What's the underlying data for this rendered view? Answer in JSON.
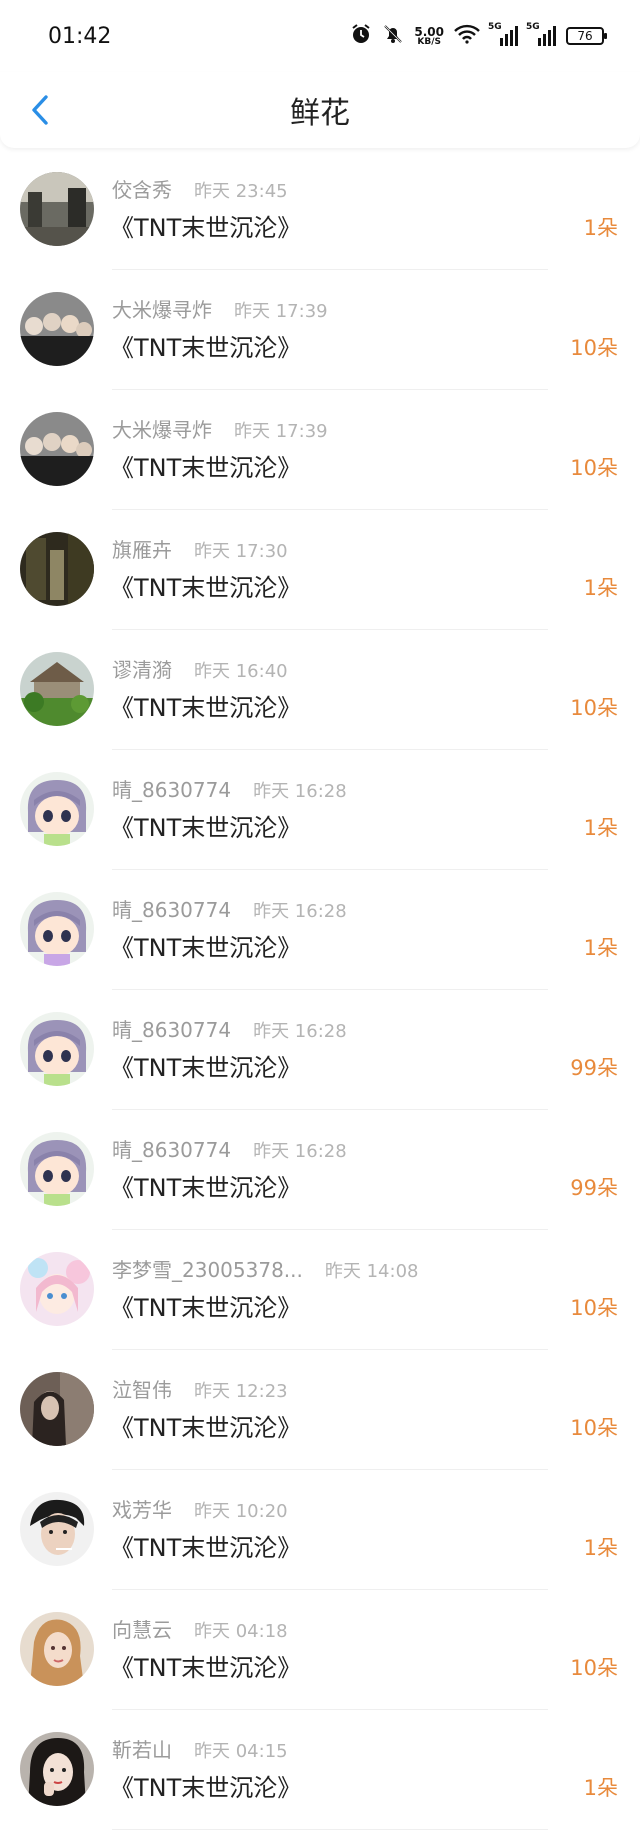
{
  "status_bar": {
    "time": "01:42",
    "net_speed": "5.00",
    "net_unit": "KB/S",
    "signal1_label": "5G",
    "signal2_label": "5G",
    "battery": "76"
  },
  "header": {
    "title": "鲜花"
  },
  "items": [
    {
      "username": "佼含秀",
      "time": "昨天 23:45",
      "book": "《TNT末世沉沦》",
      "count": "1朵"
    },
    {
      "username": "大米爆寻炸",
      "time": "昨天 17:39",
      "book": "《TNT末世沉沦》",
      "count": "10朵"
    },
    {
      "username": "大米爆寻炸",
      "time": "昨天 17:39",
      "book": "《TNT末世沉沦》",
      "count": "10朵"
    },
    {
      "username": "旗雁卉",
      "time": "昨天 17:30",
      "book": "《TNT末世沉沦》",
      "count": "1朵"
    },
    {
      "username": "谬清漪",
      "time": "昨天 16:40",
      "book": "《TNT末世沉沦》",
      "count": "10朵"
    },
    {
      "username": "晴_8630774",
      "time": "昨天 16:28",
      "book": "《TNT末世沉沦》",
      "count": "1朵"
    },
    {
      "username": "晴_8630774",
      "time": "昨天 16:28",
      "book": "《TNT末世沉沦》",
      "count": "1朵"
    },
    {
      "username": "晴_8630774",
      "time": "昨天 16:28",
      "book": "《TNT末世沉沦》",
      "count": "99朵"
    },
    {
      "username": "晴_8630774",
      "time": "昨天 16:28",
      "book": "《TNT末世沉沦》",
      "count": "99朵"
    },
    {
      "username": "李梦雪_23005378...",
      "time": "昨天 14:08",
      "book": "《TNT末世沉沦》",
      "count": "10朵"
    },
    {
      "username": "泣智伟",
      "time": "昨天 12:23",
      "book": "《TNT末世沉沦》",
      "count": "10朵"
    },
    {
      "username": "戏芳华",
      "time": "昨天 10:20",
      "book": "《TNT末世沉沦》",
      "count": "1朵"
    },
    {
      "username": "向慧云",
      "time": "昨天 04:18",
      "book": "《TNT末世沉沦》",
      "count": "10朵"
    },
    {
      "username": "靳若山",
      "time": "昨天 04:15",
      "book": "《TNT末世沉沦》",
      "count": "1朵"
    }
  ],
  "colors": {
    "accent_count": "#e88a3c",
    "back_arrow": "#2a8ee6"
  }
}
